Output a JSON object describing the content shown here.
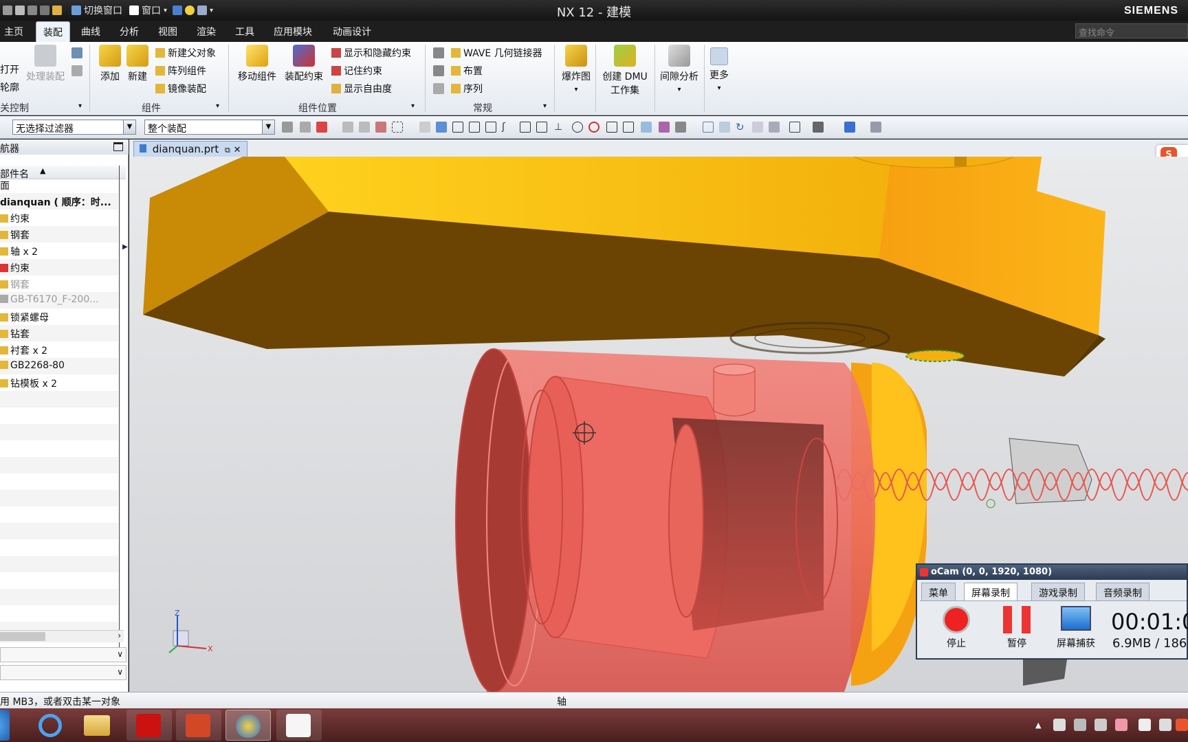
{
  "window": {
    "title": "NX 12 - 建模",
    "brand": "SIEMENS",
    "quick_access": [
      "切换窗口",
      "窗口"
    ]
  },
  "menu": {
    "tabs": [
      "主页",
      "装配",
      "曲线",
      "分析",
      "视图",
      "渲染",
      "工具",
      "应用模块",
      "动画设计"
    ],
    "active_tab": "装配",
    "search_placeholder": "查找命令"
  },
  "ribbon": {
    "left_partial": {
      "open": "打开",
      "outline": "轮廓",
      "process_assembly": "处理装配",
      "group": "关控制"
    },
    "component": {
      "add": "添加",
      "new": "新建",
      "new_parent": "新建父对象",
      "array": "阵列组件",
      "mirror": "镜像装配",
      "group": "组件"
    },
    "position": {
      "move": "移动组件",
      "constraint": "装配约束",
      "show_hide": "显示和隐藏约束",
      "remember": "记住约束",
      "dof": "显示自由度",
      "group": "组件位置"
    },
    "general": {
      "wave": "WAVE 几何链接器",
      "layout": "布置",
      "sequence": "序列",
      "group": "常规"
    },
    "explode": "爆炸图",
    "dmu": [
      "创建 DMU",
      "工作集"
    ],
    "clearance": "间隙分析",
    "more": "更多"
  },
  "toolbar": {
    "filter": "无选择过滤器",
    "scope": "整个装配"
  },
  "navigator": {
    "title": "航器",
    "column": "部件名",
    "rows": [
      {
        "label": "面",
        "dim": false
      },
      {
        "label": "dianquan ( 顺序：时...",
        "dim": false,
        "bold": true
      },
      {
        "label": "约束",
        "dim": false
      },
      {
        "label": "钢套",
        "dim": false
      },
      {
        "label": "轴 x 2",
        "dim": false
      },
      {
        "label": "约束",
        "dim": false
      },
      {
        "label": "钢套",
        "dim": true
      },
      {
        "label": "GB-T6170_F-200...",
        "dim": true
      },
      {
        "label": "锁紧螺母",
        "dim": false
      },
      {
        "label": "钻套",
        "dim": false
      },
      {
        "label": "衬套 x 2",
        "dim": false
      },
      {
        "label": "GB2268-80",
        "dim": false
      },
      {
        "label": "钻模板 x 2",
        "dim": false
      }
    ]
  },
  "document_tab": "dianquan.prt",
  "status": {
    "left": "用 MB3，或者双击某一对象",
    "center": "轴"
  },
  "ocam": {
    "title": "oCam (0, 0, 1920, 1080)",
    "tabs": [
      "菜单",
      "屏幕录制",
      "游戏录制",
      "音频录制"
    ],
    "active_tab": "屏幕录制",
    "buttons": [
      "停止",
      "暂停",
      "屏幕捕获"
    ],
    "time": "00:01:0",
    "size": "6.9MB / 186."
  },
  "axis": {
    "z": "Z",
    "x": "X"
  },
  "colors": {
    "accent": "#2b5797",
    "part_yellow": "#f6b20f",
    "part_red": "#ee6a62"
  }
}
